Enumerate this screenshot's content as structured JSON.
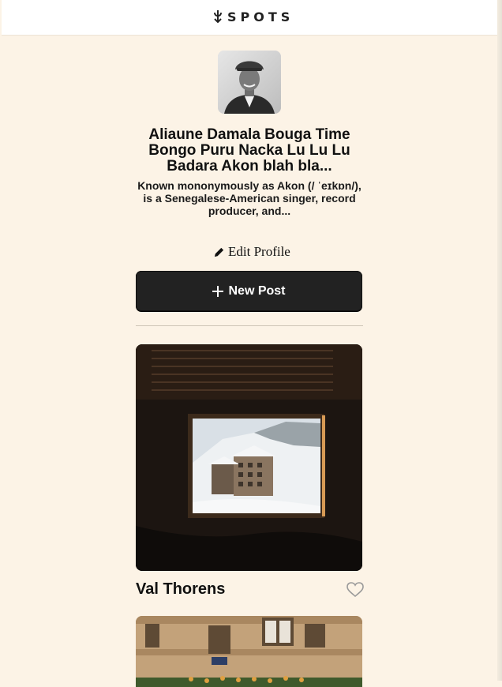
{
  "header": {
    "logo_text": "SPOTS",
    "logo_icon": "sprout-icon"
  },
  "profile": {
    "name": "Aliaune Damala Bouga Time Bongo Puru Nacka Lu Lu Lu Badara Akon blah bla...",
    "bio": "Known mononymously as Akon (/ ˈeɪkɒn/), is a Senegalese-American singer, record producer, and...",
    "edit_label": "Edit Profile"
  },
  "actions": {
    "new_post_label": "New Post"
  },
  "cards": [
    {
      "title": "Val Thorens",
      "liked": false
    },
    {
      "title": ""
    }
  ],
  "colors": {
    "background": "#fcf3e6",
    "button": "#222222",
    "text": "#111111"
  }
}
